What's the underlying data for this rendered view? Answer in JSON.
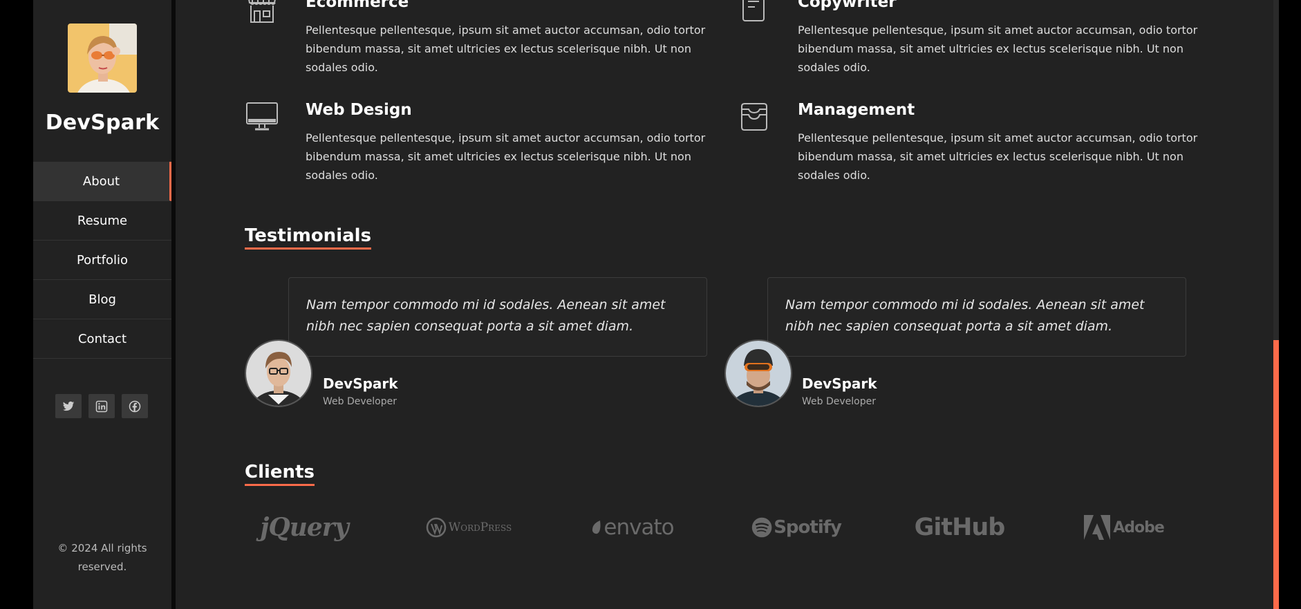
{
  "brand": {
    "name": "DevSpark"
  },
  "nav": {
    "items": [
      {
        "label": "About"
      },
      {
        "label": "Resume"
      },
      {
        "label": "Portfolio"
      },
      {
        "label": "Blog"
      },
      {
        "label": "Contact"
      }
    ],
    "active": "About"
  },
  "social": [
    "twitter-icon",
    "linkedin-icon",
    "facebook-icon"
  ],
  "copyright": {
    "line1": "© 2024 All rights",
    "line2": "reserved."
  },
  "services": [
    {
      "title": "Ecommerce",
      "icon": "storefront-icon",
      "text": "Pellentesque pellentesque, ipsum sit amet auctor accumsan, odio tortor bibendum massa, sit amet ultricies ex lectus scelerisque nibh. Ut non sodales odio."
    },
    {
      "title": "Copywriter",
      "icon": "document-icon",
      "text": "Pellentesque pellentesque, ipsum sit amet auctor accumsan, odio tortor bibendum massa, sit amet ultricies ex lectus scelerisque nibh. Ut non sodales odio."
    },
    {
      "title": "Web Design",
      "icon": "monitor-icon",
      "text": "Pellentesque pellentesque, ipsum sit amet auctor accumsan, odio tortor bibendum massa, sit amet ultricies ex lectus scelerisque nibh. Ut non sodales odio."
    },
    {
      "title": "Management",
      "icon": "inbox-icon",
      "text": "Pellentesque pellentesque, ipsum sit amet auctor accumsan, odio tortor bibendum massa, sit amet ultricies ex lectus scelerisque nibh. Ut non sodales odio."
    }
  ],
  "testimonials": {
    "title": "Testimonials",
    "items": [
      {
        "quote": "Nam tempor commodo mi id sodales. Aenean sit amet nibh nec sapien consequat porta a sit amet diam.",
        "name": "DevSpark",
        "role": "Web Developer"
      },
      {
        "quote": "Nam tempor commodo mi id sodales. Aenean sit amet nibh nec sapien consequat porta a sit amet diam.",
        "name": "DevSpark",
        "role": "Web Developer"
      }
    ]
  },
  "clients": {
    "title": "Clients",
    "logos": [
      "jQuery",
      "WordPress",
      "envato",
      "Spotify",
      "GitHub",
      "Adobe"
    ]
  },
  "colors": {
    "accent": "#ff6b4a",
    "background": "#222222",
    "sidebar": "#222222",
    "text": "#ffffff"
  }
}
